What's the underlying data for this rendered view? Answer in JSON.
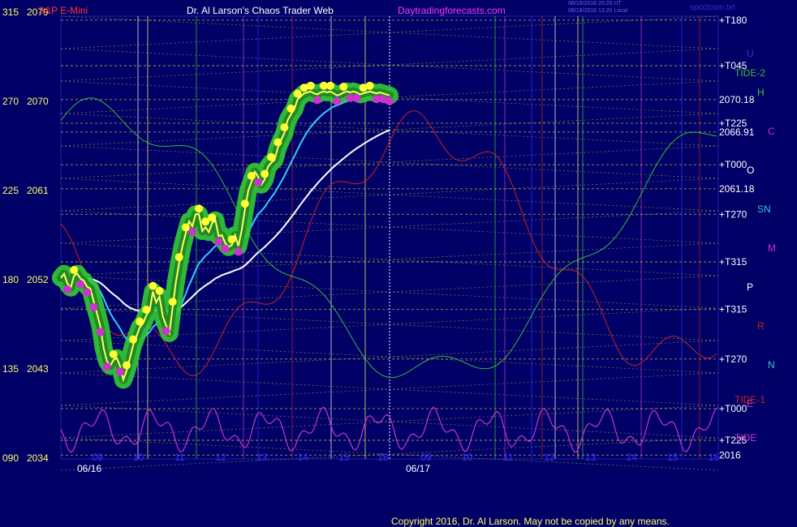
{
  "header": {
    "instrument": "S&P E-Mini",
    "title": "Dr. Al Larson's Chaos Trader Web",
    "site": "Daytradingforecasts.com",
    "stamp1": "06/16/2016 20:20 UT",
    "stamp2": "06/16/2016 13:20 Local",
    "filename": "spcctcom.txt"
  },
  "copyright": "Copyright 2016, Dr. Al Larson. May not be copied by any means.",
  "colors": {
    "background": "#000066",
    "price_halo": "#33cc33",
    "price_line": "#ffff66",
    "ema_fast": "#33ccff",
    "ema_slow": "#ffffff",
    "cycle": "#cc33cc",
    "tide_red": "#cc2222",
    "tide_green": "#33bb33",
    "grid": "#cccc44",
    "mover_icon": "yellow-dot",
    "mover_icon_down": "magenta-dot"
  },
  "chart_data": {
    "type": "line",
    "ylabel": "",
    "xlabel": "",
    "ylim": [
      2034,
      2079
    ],
    "angle_ticks": [
      {
        "angle": "315",
        "price": "2079"
      },
      {
        "angle": "270",
        "price": "2070"
      },
      {
        "angle": "225",
        "price": "2061"
      },
      {
        "angle": "180",
        "price": "2052"
      },
      {
        "angle": "135",
        "price": "2043"
      },
      {
        "angle": "090",
        "price": "2034"
      }
    ],
    "dates": [
      "06/16",
      "06/17"
    ],
    "hour_ticks_day1": [
      "09",
      "10",
      "11",
      "12",
      "13",
      "14",
      "15",
      "16"
    ],
    "hour_ticks_day2": [
      "09",
      "10",
      "11",
      "12",
      "13",
      "14",
      "15",
      "16"
    ],
    "right_scale": [
      {
        "label": "T180",
        "price": 2078.2
      },
      {
        "label": "T045",
        "price": 2073.6
      },
      {
        "label": "2070.18",
        "price": 2070.18
      },
      {
        "label": "T225",
        "price": 2067.8
      },
      {
        "label": "2066.91",
        "price": 2066.91
      },
      {
        "label": "T000",
        "price": 2063.6
      },
      {
        "label": "2061.18",
        "price": 2061.18
      },
      {
        "label": "T270",
        "price": 2058.6
      },
      {
        "label": "T315",
        "price": 2053.8
      },
      {
        "label": "T315",
        "price": 2049.0
      },
      {
        "label": "T270",
        "price": 2044.0
      },
      {
        "label": "T000",
        "price": 2039.0
      },
      {
        "label": "T225",
        "price": 2035.8
      },
      {
        "label": "2016",
        "price": 2034.3
      }
    ],
    "planet_labels": [
      {
        "text": "U",
        "color": "#3333cc"
      },
      {
        "text": "H",
        "color": "#33cc33"
      },
      {
        "text": "C",
        "color": "#cc33cc"
      },
      {
        "text": "O",
        "color": "#ffffff"
      },
      {
        "text": "SN",
        "color": "#33cccc"
      },
      {
        "text": "M",
        "color": "#cc33cc"
      },
      {
        "text": "P",
        "color": "#ffffff"
      },
      {
        "text": "R",
        "color": "#cc2222"
      },
      {
        "text": "N",
        "color": "#33cccc"
      },
      {
        "text": "E",
        "color": "#cc33cc"
      }
    ],
    "tide_labels": [
      "TIDE-2",
      "TIDE-1",
      "TIDE"
    ],
    "series": [
      {
        "name": "",
        "x": [
          0,
          4,
          8,
          12,
          16,
          20,
          24,
          28,
          32,
          36,
          40,
          44,
          48,
          52,
          56,
          60,
          64,
          68,
          72,
          76,
          80,
          84,
          88,
          92,
          96,
          100,
          104,
          108,
          112,
          116,
          120,
          124,
          128,
          132,
          136,
          140,
          144,
          148,
          152,
          156,
          160,
          164,
          168,
          172,
          176,
          180,
          184,
          188,
          192,
          196,
          200,
          204,
          208,
          212,
          216,
          220,
          224,
          228,
          232,
          236,
          240,
          244,
          248,
          252,
          256,
          260,
          264,
          268,
          272,
          276,
          280,
          284,
          288,
          292,
          296,
          300,
          304,
          308,
          312,
          316,
          320,
          324,
          328,
          332,
          336,
          340,
          344,
          348,
          352,
          356,
          360,
          364,
          368,
          372,
          376,
          380,
          384,
          388,
          392,
          396,
          400
        ],
        "values": [
          2052.2,
          2052.6,
          2051.6,
          2051.2,
          2052.4,
          2052.6,
          2052.1,
          2051.9,
          2051.3,
          2051.1,
          2049.8,
          2048.6,
          2047.3,
          2045.1,
          2043.8,
          2043.3,
          2043.9,
          2044.1,
          2043.3,
          2041.9,
          2042.8,
          2044.1,
          2045.4,
          2046.3,
          2047.2,
          2047.6,
          2048.4,
          2048.9,
          2050.8,
          2049.7,
          2050.3,
          2048.3,
          2047.4,
          2046.6,
          2049.2,
          2051.8,
          2053.7,
          2055.4,
          2056.7,
          2057.9,
          2057.4,
          2058.6,
          2058.6,
          2056.9,
          2057.3,
          2056.8,
          2057.7,
          2058.0,
          2056.4,
          2056.5,
          2055.7,
          2055.3,
          2055.5,
          2056.5,
          2055.4,
          2057.0,
          2059.1,
          2061.0,
          2061.9,
          2062.9,
          2062.4,
          2061.6,
          2062.1,
          2063.4,
          2063.8,
          2064.1,
          2065.3,
          2066.1,
          2066.8,
          2068.1,
          2068.7,
          2069.2,
          2070.2,
          2070.5,
          2070.8,
          2070.9,
          2071.0,
          2070.8,
          2070.7,
          2070.9,
          2071.0,
          2070.9,
          2071.0,
          2070.8,
          2070.6,
          2070.7,
          2070.9,
          2071.0,
          2070.9,
          2071.0,
          2070.9,
          2070.7,
          2070.8,
          2070.9,
          2071.0,
          2070.9,
          2070.8,
          2070.9,
          2070.8,
          2070.7,
          2070.6
        ]
      }
    ],
    "grid": true,
    "legend": "none"
  }
}
